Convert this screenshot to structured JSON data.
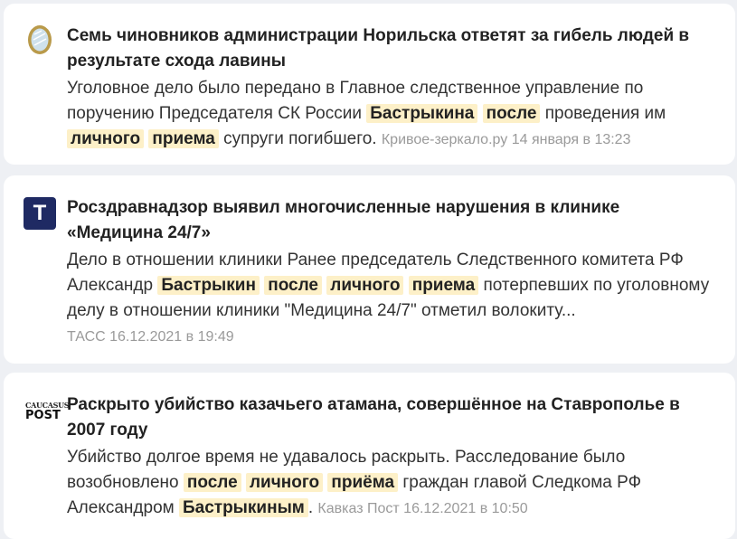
{
  "items": [
    {
      "icon": "mirror-icon",
      "title": "Семь чиновников администрации Норильска ответят за гибель людей в результате схода лавины",
      "snippet": [
        {
          "t": "Уголовное дело было передано в Главное следственное управление по поручению Председателя СК России "
        },
        {
          "t": "Бастрыкина",
          "hl": true
        },
        {
          "t": " "
        },
        {
          "t": "после",
          "hl": true
        },
        {
          "t": " проведения им "
        },
        {
          "t": "личного",
          "hl": true
        },
        {
          "t": " "
        },
        {
          "t": "приема",
          "hl": true
        },
        {
          "t": " супруги погибшего. "
        }
      ],
      "source": "Кривое-зеркало.ру",
      "date": "14 января в 13:23",
      "meta_inline": true
    },
    {
      "icon": "tass-logo",
      "logo_text": "T",
      "title": "Росздравнадзор выявил многочисленные нарушения в клинике «Медицина 24/7»",
      "snippet": [
        {
          "t": "Дело в отношении клиники Ранее председатель Следственного комитета РФ Александр "
        },
        {
          "t": "Бастрыкин",
          "hl": true
        },
        {
          "t": " "
        },
        {
          "t": "после",
          "hl": true
        },
        {
          "t": " "
        },
        {
          "t": "личного",
          "hl": true
        },
        {
          "t": " "
        },
        {
          "t": "приема",
          "hl": true
        },
        {
          "t": " потерпевших по уголовному делу в отношении клиники \"Медицина 24/7\" отметил волокиту..."
        }
      ],
      "source": "ТАСС",
      "date": "16.12.2021 в 19:49",
      "meta_inline": false
    },
    {
      "icon": "caucasus-post-logo",
      "logo_line1": "CAUCASUS",
      "logo_line2": "POST",
      "title": "Раскрыто убийство казачьего атамана, совершённое на Ставрополье в 2007 году",
      "snippet": [
        {
          "t": "Убийство долгое время не удавалось раскрыть. Расследование было возобновлено "
        },
        {
          "t": "после",
          "hl": true
        },
        {
          "t": " "
        },
        {
          "t": "личного",
          "hl": true
        },
        {
          "t": " "
        },
        {
          "t": "приёма",
          "hl": true
        },
        {
          "t": " граждан главой Следкома РФ Александром "
        },
        {
          "t": "Бастрыкиным",
          "hl": true
        },
        {
          "t": ". "
        }
      ],
      "source": "Кавказ Пост",
      "date": "16.12.2021 в 10:50",
      "meta_inline": true
    }
  ]
}
